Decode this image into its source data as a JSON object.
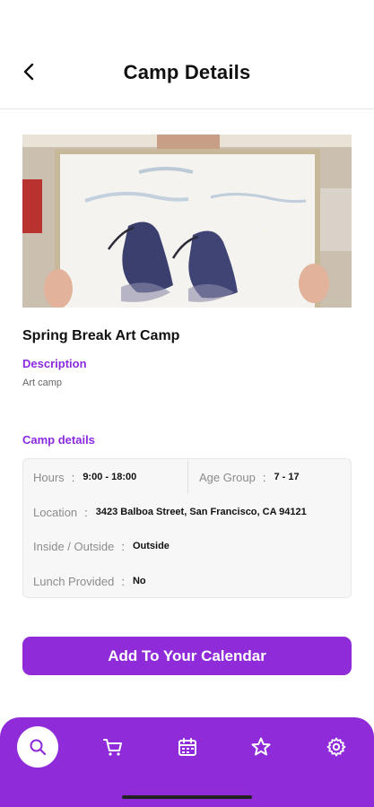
{
  "header": {
    "title": "Camp Details",
    "back_icon": "chevron-left-icon"
  },
  "camp": {
    "name": "Spring Break Art Camp",
    "description_label": "Description",
    "description": "Art camp",
    "details_label": "Camp details"
  },
  "details": {
    "hours": {
      "label": "Hours",
      "value": "9:00 - 18:00"
    },
    "age_group": {
      "label": "Age Group",
      "value": "7 - 17"
    },
    "location": {
      "label": "Location",
      "value": "3423 Balboa Street, San Francisco, CA 94121"
    },
    "inside_outside": {
      "label": "Inside / Outside",
      "value": "Outside"
    },
    "lunch": {
      "label": "Lunch Provided",
      "value": "No"
    },
    "separator": ":"
  },
  "cta": {
    "label": "Add To Your Calendar"
  },
  "tabbar": {
    "items": [
      {
        "icon": "search-icon",
        "active": true
      },
      {
        "icon": "cart-icon",
        "active": false
      },
      {
        "icon": "calendar-icon",
        "active": false
      },
      {
        "icon": "star-icon",
        "active": false
      },
      {
        "icon": "gear-icon",
        "active": false
      }
    ]
  },
  "colors": {
    "accent": "#8f2bd8",
    "text": "#111111",
    "muted": "#8c8c8c"
  }
}
